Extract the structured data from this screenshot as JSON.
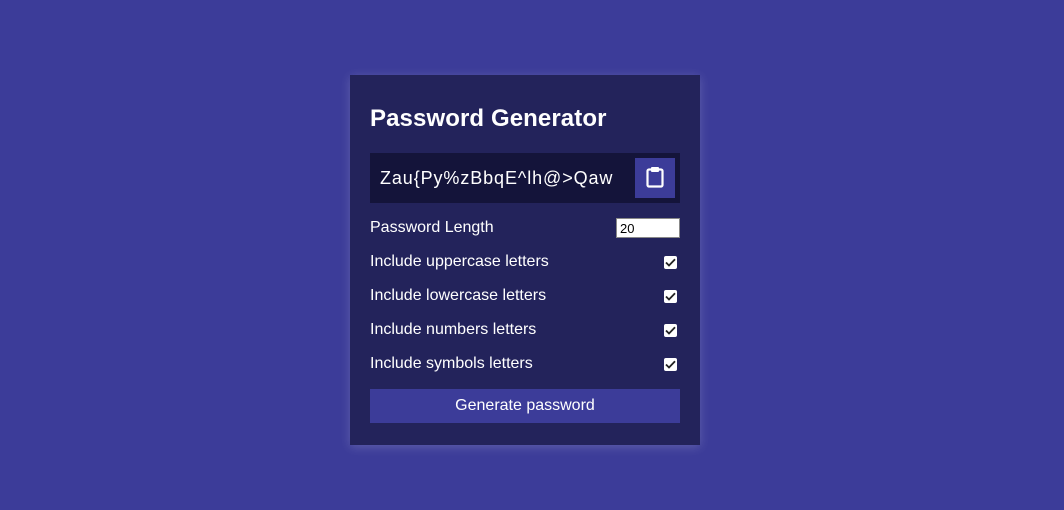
{
  "app": {
    "title": "Password Generator"
  },
  "result": {
    "password": "Zau{Py%zBbqE^lh@>Qaw",
    "copy_icon": "clipboard-icon"
  },
  "settings": {
    "length_label": "Password Length",
    "length_value": "20",
    "options": [
      {
        "label": "Include uppercase letters",
        "checked": true
      },
      {
        "label": "Include lowercase letters",
        "checked": true
      },
      {
        "label": "Include numbers letters",
        "checked": true
      },
      {
        "label": "Include symbols letters",
        "checked": true
      }
    ]
  },
  "generate": {
    "label": "Generate password"
  },
  "colors": {
    "background": "#3c3c99",
    "card": "#23235b",
    "result_bg": "#14143a",
    "button": "#3c3c99"
  }
}
